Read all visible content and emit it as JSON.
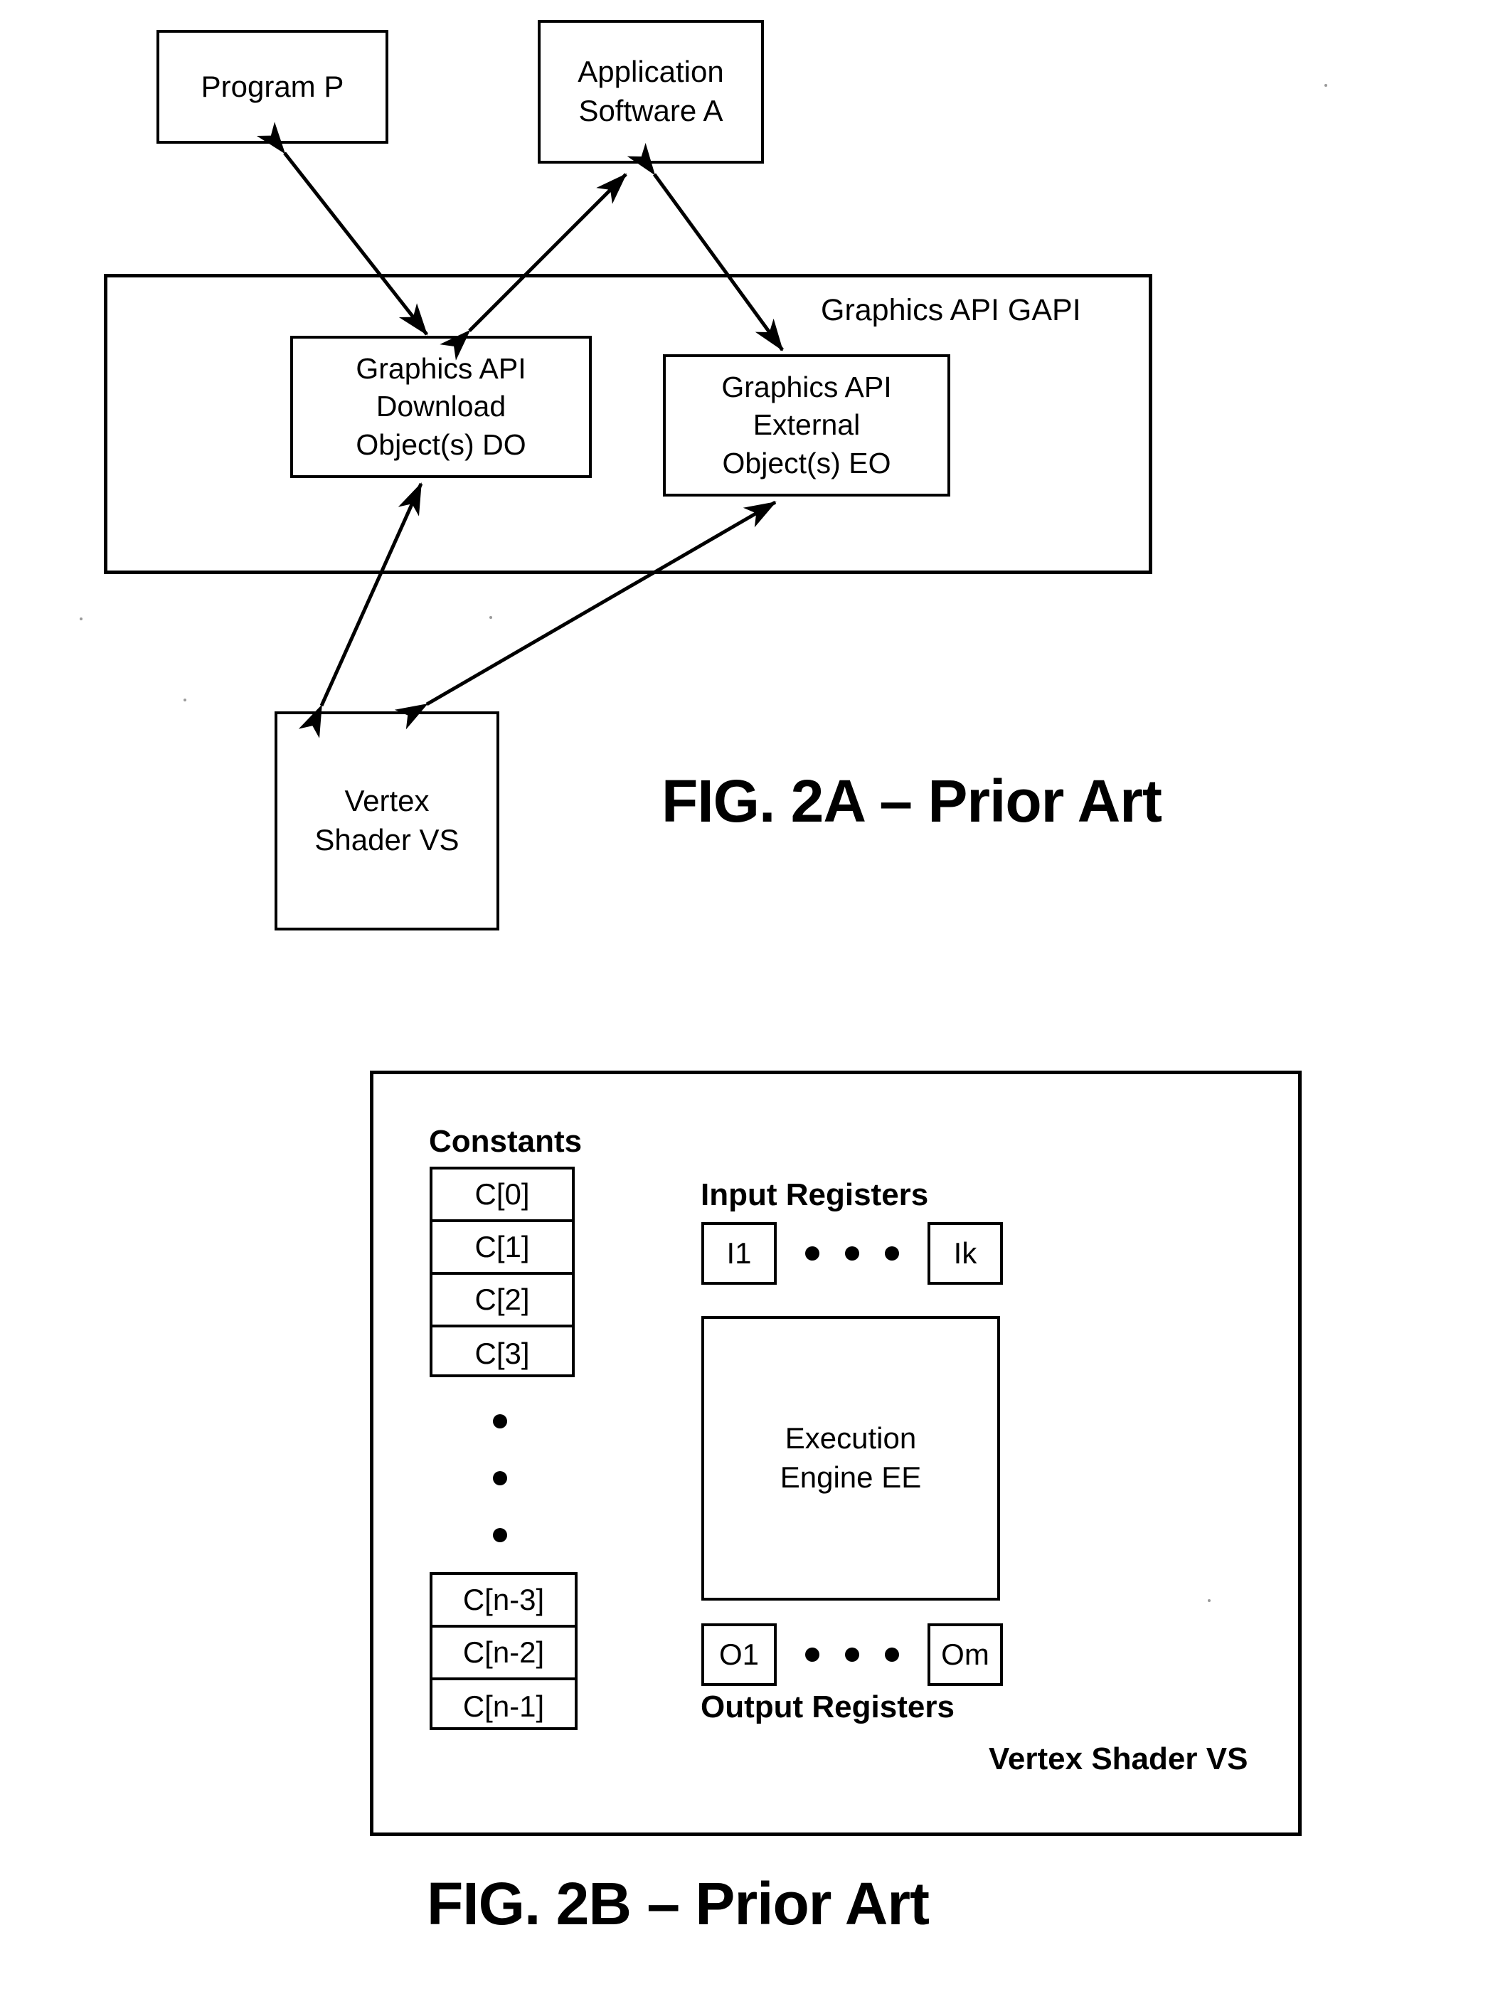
{
  "figures": [
    {
      "id": "fig2a",
      "caption": "FIG. 2A – Prior Art",
      "boxes": {
        "program": "Program P",
        "application_line1": "Application",
        "application_line2": "Software A",
        "gapi_label": "Graphics API GAPI",
        "download_object_line1": "Graphics API",
        "download_object_line2": "Download",
        "download_object_line3": "Object(s) DO",
        "external_object_line1": "Graphics API",
        "external_object_line2": "External",
        "external_object_line3": "Object(s) EO",
        "vertex_shader_line1": "Vertex",
        "vertex_shader_line2": "Shader VS"
      }
    },
    {
      "id": "fig2b",
      "caption": "FIG. 2B – Prior Art",
      "labels": {
        "constants": "Constants",
        "input_registers": "Input Registers",
        "output_registers": "Output Registers",
        "vertex_shader": "Vertex Shader VS",
        "execution_engine_line1": "Execution",
        "execution_engine_line2": "Engine EE"
      },
      "constants_top": [
        "C[0]",
        "C[1]",
        "C[2]",
        "C[3]"
      ],
      "constants_bottom": [
        "C[n-3]",
        "C[n-2]",
        "C[n-1]"
      ],
      "input_registers": {
        "first": "I1",
        "last": "Ik",
        "ellipsis_dots": 3
      },
      "output_registers": {
        "first": "O1",
        "last": "Om",
        "ellipsis_dots": 3
      },
      "constants_ellipsis_dots": 3
    }
  ],
  "colors": {
    "ink": "#000000",
    "paper": "#ffffff"
  }
}
